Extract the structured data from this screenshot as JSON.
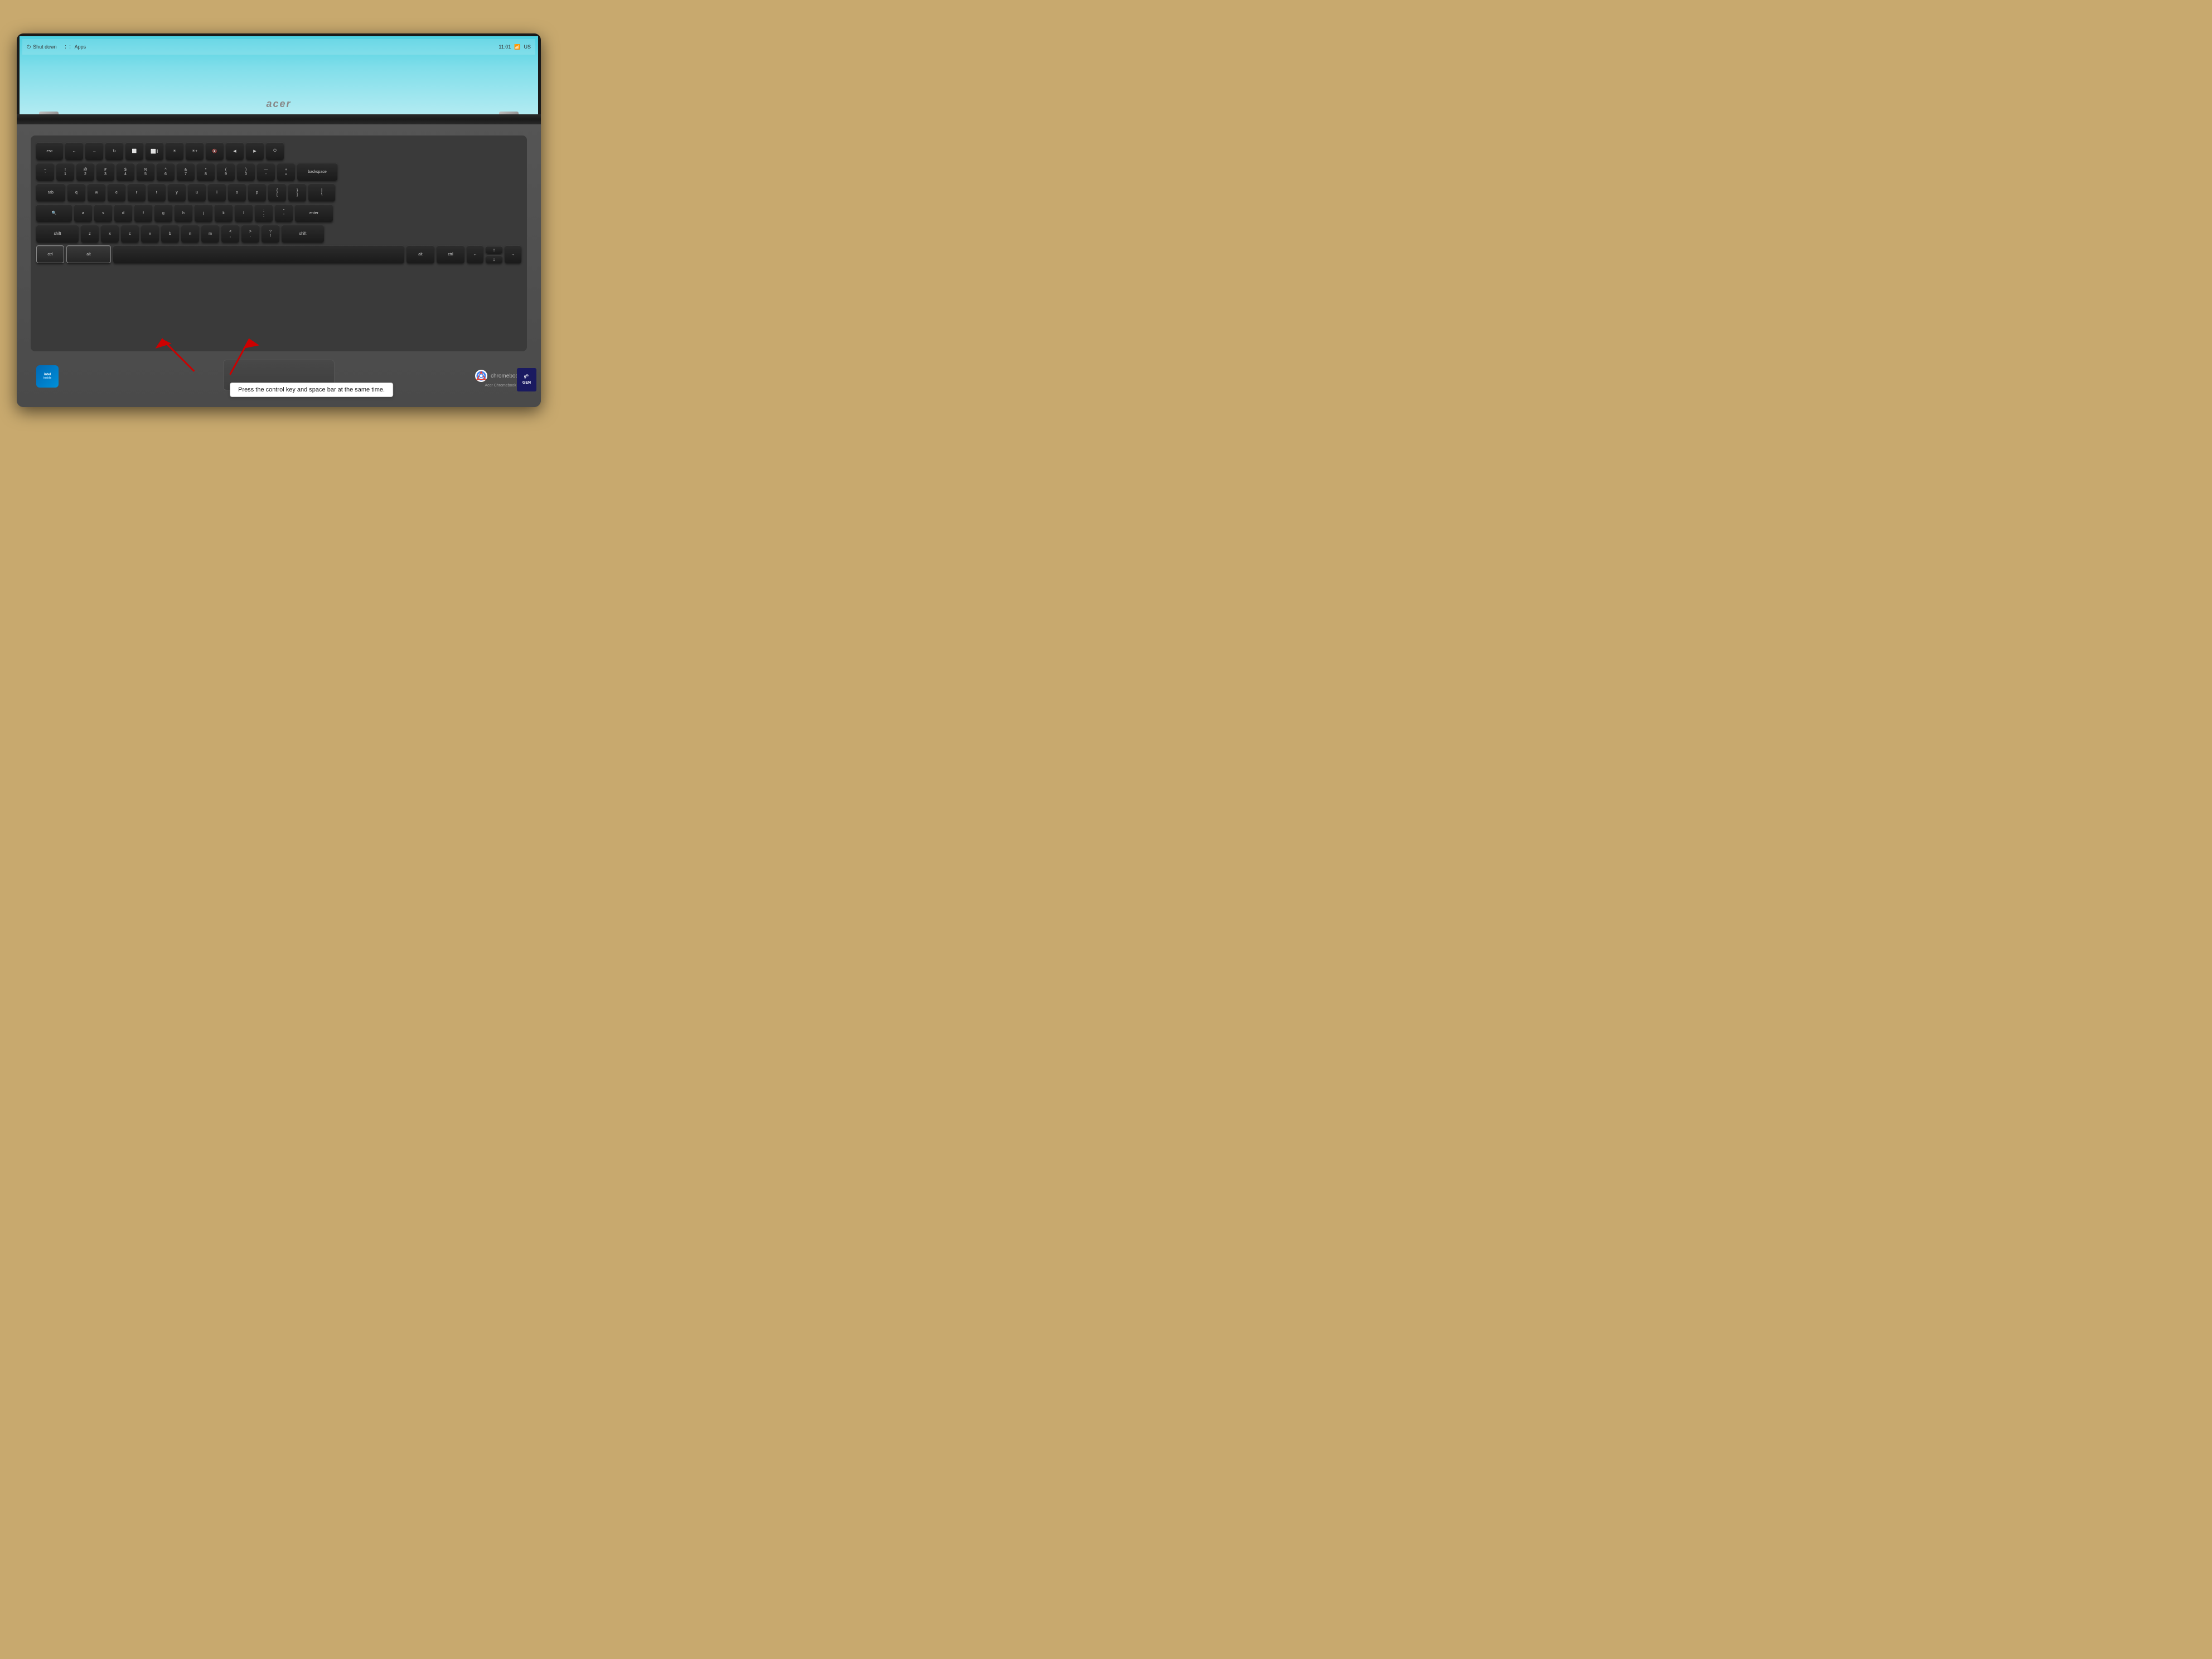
{
  "taskbar": {
    "shutdown_label": "Shut down",
    "apps_label": "Apps",
    "time": "11:01",
    "locale": "US"
  },
  "screen": {
    "brand": "acer"
  },
  "caption": {
    "text": "Press the control key and space bar at the same time."
  },
  "keyboard": {
    "row1": [
      "esc",
      "←",
      "→",
      "↺",
      "⬜",
      "⬜||",
      "☀",
      "☀+",
      "🔇",
      "◀",
      "▶",
      "⏻"
    ],
    "row2_numbers": [
      "~\n`",
      "!\n1",
      "@\n2",
      "#\n3",
      "$\n4",
      "%\n5",
      "^\n6",
      "&\n7",
      "*\n8",
      "(\n9",
      ")\n0",
      "—\n-",
      "+\n=",
      "backspace"
    ],
    "row3": [
      "tab",
      "q",
      "w",
      "e",
      "r",
      "t",
      "y",
      "u",
      "i",
      "o",
      "p",
      "{\n[",
      "}\n]",
      "|\\"
    ],
    "row4": [
      "🔍",
      "a",
      "s",
      "d",
      "f",
      "g",
      "h",
      "j",
      "k",
      "l",
      ":\n;",
      "\"\n'",
      "enter"
    ],
    "row5": [
      "shift",
      "z",
      "x",
      "c",
      "v",
      "b",
      "n",
      "m",
      "<\n,",
      ">\n.",
      "?\n/",
      "shift"
    ],
    "row6": [
      "ctrl",
      "alt",
      "",
      "alt",
      "ctrl",
      "<",
      "↑\n↓",
      ">"
    ]
  },
  "badges": {
    "intel": "intel",
    "intel_inside": "inside",
    "chromebook": "chromebook",
    "acer_model": "Acer Chromebook 11",
    "gen": "5th\nGEN"
  }
}
